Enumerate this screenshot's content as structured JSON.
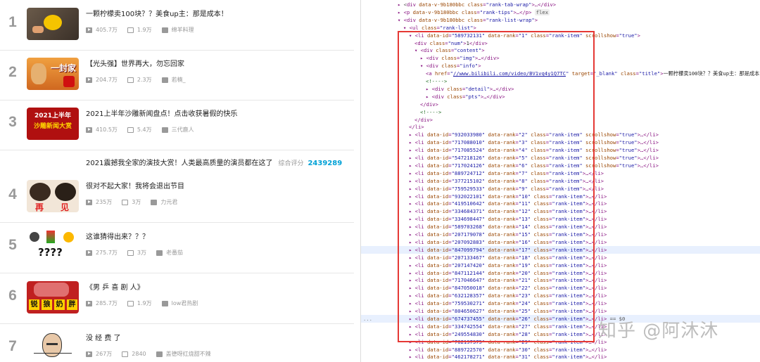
{
  "rank_list": {
    "items": [
      {
        "rank": "1",
        "title": "一颗柠檬卖100块？？美食up主：那是成本！",
        "views": "405.7万",
        "danmaku": "1.9万",
        "up": "绵羊料理",
        "thumb": "thumb-lemon"
      },
      {
        "rank": "2",
        "title": "【光头强】世界再大，勿忘回家",
        "views": "204.7万",
        "danmaku": "2.3万",
        "up": "若楠_",
        "thumb": "thumb-cartoon"
      },
      {
        "rank": "3",
        "title": "2021上半年沙雕新闻盘点！点击收获暑假的快乐",
        "views": "410.5万",
        "danmaku": "5.4万",
        "up": "三代鹿人",
        "thumb": "thumb-news"
      },
      {
        "rank": "4",
        "title": "很对不起大家！我将会退出节目",
        "views": "235万",
        "danmaku": "3万",
        "up": "力元君",
        "thumb": "thumb-goodbye"
      },
      {
        "rank": "5",
        "title": "这谁猜得出来？？？",
        "views": "275.7万",
        "danmaku": "3万",
        "up": "老番茄",
        "thumb": "thumb-emoji"
      },
      {
        "rank": "6",
        "title": "《男 乒 喜 剧 人》",
        "views": "285.7万",
        "danmaku": "1.9万",
        "up": "low君热剧",
        "thumb": "thumb-pingpong"
      },
      {
        "rank": "7",
        "title": "没 经 费 了",
        "views": "267万",
        "danmaku": "2840",
        "up": "盖德呀红烧甜不辣",
        "thumb": "thumb-meme"
      }
    ],
    "sub_item": {
      "title": "2021震撼我全家的演技大赏！人类最高质量的演员都在这了",
      "score_label": "综合评分",
      "score": "2439289"
    },
    "thumb_text": {
      "cartoon": "一封家",
      "news_line1": "2021上半年",
      "news_line2": "沙雕新闻大赏",
      "goodbye_a": "再",
      "goodbye_b": "见",
      "emoji_q": "????",
      "pingpong": [
        "锐",
        "狼",
        "奶",
        "胖"
      ]
    }
  },
  "devtools": {
    "lines": [
      {
        "i": 2,
        "html": "▸ <span class='tw'>&lt;</span>div <span class='an'>data-v-9b180bbc</span> <span class='an'>class</span>=<span class='av'>\"rank-tab-wrap\"</span>&gt;…&lt;/div&gt;"
      },
      {
        "i": 2,
        "html": "▸ &lt;p <span class='an'>data-v-9b180bbc</span> <span class='an'>class</span>=<span class='av'>\"rank-tips\"</span>&gt;…&lt;/p&gt; <span class='fx'>flex</span>"
      },
      {
        "i": 2,
        "html": "▾ &lt;div <span class='an'>data-v-9b180bbc</span> <span class='an'>class</span>=<span class='av'>\"rank-list-wrap\"</span>&gt;"
      },
      {
        "i": 3,
        "html": "▾ &lt;ul <span class='an'>class</span>=<span class='av'>\"rank-list\"</span>&gt;"
      },
      {
        "i": 4,
        "html": "▾ &lt;li <span class='an'>data-id</span>=<span class='av'>\"589732131\"</span> <span class='an'>data-rank</span>=<span class='av'>\"1\"</span> <span class='an'>class</span>=<span class='av'>\"rank-item\"</span> <span class='an'>scrollshow</span>=<span class='av'>\"true\"</span>&gt;"
      },
      {
        "i": 5,
        "html": "&lt;div <span class='an'>class</span>=<span class='av'>\"num\"</span>&gt;<span class='tx'>1</span>&lt;/div&gt;"
      },
      {
        "i": 5,
        "html": "▾ &lt;div <span class='an'>class</span>=<span class='av'>\"content\"</span>&gt;"
      },
      {
        "i": 6,
        "html": "▸ &lt;div <span class='an'>class</span>=<span class='av'>\"img\"</span>&gt;…&lt;/div&gt;"
      },
      {
        "i": 6,
        "html": "▾ &lt;div <span class='an'>class</span>=<span class='av'>\"info\"</span>&gt;"
      },
      {
        "i": 7,
        "html": "&lt;a <span class='an'>href</span>=<span class='av'>\"<span class='lk'>//www.bilibili.com/video/BV1vq4y1Q7TC</span>\"</span> <span class='an'>target</span>=<span class='av'>\"_blank\"</span> <span class='an'>class</span>=<span class='av'>\"title\"</span>&gt;<span class='tx'>一颗柠檬卖100块？？美食up主：那是成本！</span>"
      },
      {
        "i": 7,
        "html": "<span class='cm'>&lt;!----&gt;</span>"
      },
      {
        "i": 7,
        "html": "▸ &lt;div <span class='an'>class</span>=<span class='av'>\"detail\"</span>&gt;…&lt;/div&gt;"
      },
      {
        "i": 7,
        "html": "▸ &lt;div <span class='an'>class</span>=<span class='av'>\"pts\"</span>&gt;…&lt;/div&gt;"
      },
      {
        "i": 6,
        "html": "&lt;/div&gt;"
      },
      {
        "i": 6,
        "html": "<span class='cm'>&lt;!----&gt;</span>"
      },
      {
        "i": 5,
        "html": "&lt;/div&gt;"
      },
      {
        "i": 4,
        "html": "&lt;/li&gt;"
      }
    ],
    "li_rows": [
      [
        "932033980",
        "2"
      ],
      [
        "717088010",
        "3"
      ],
      [
        "717085524",
        "4"
      ],
      [
        "547218126",
        "5"
      ],
      [
        "717024126",
        "6"
      ],
      [
        "889724712",
        "7"
      ],
      [
        "377215102",
        "8"
      ],
      [
        "759529533",
        "9"
      ],
      [
        "932022101",
        "10"
      ],
      [
        "419510642",
        "11"
      ],
      [
        "334684371",
        "12"
      ],
      [
        "334698447",
        "13"
      ],
      [
        "589703268",
        "14"
      ],
      [
        "207179078",
        "15"
      ],
      [
        "207092883",
        "16"
      ],
      [
        "847099794",
        "17"
      ],
      [
        "207133467",
        "18"
      ],
      [
        "207147420",
        "19"
      ],
      [
        "847112144",
        "20"
      ],
      [
        "717046647",
        "21"
      ],
      [
        "847050018",
        "22"
      ],
      [
        "632128357",
        "23"
      ],
      [
        "759530271",
        "24"
      ],
      [
        "804650627",
        "25"
      ],
      [
        "674737455",
        "26"
      ],
      [
        "334742554",
        "27"
      ],
      [
        "249554830",
        "28"
      ],
      [
        "762197375",
        "29"
      ],
      [
        "889722570",
        "30"
      ],
      [
        "462178271",
        "31"
      ]
    ],
    "selected_suffix": " == $0",
    "watermark": "知乎 @阿沐沐"
  }
}
